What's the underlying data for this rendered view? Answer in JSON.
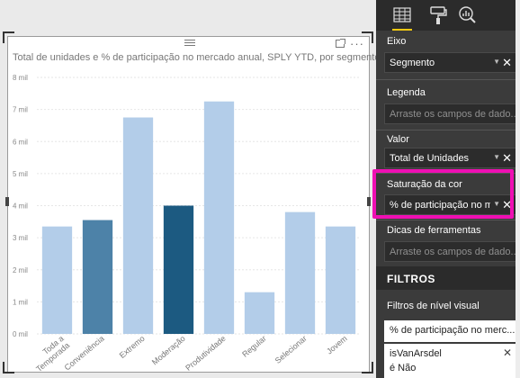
{
  "visual": {
    "title": "Total de unidades e % de participação no mercado anual, SPLY YTD, por segmento",
    "more_glyph": "···"
  },
  "chart_data": {
    "type": "bar",
    "title": "Total de unidades e % de participação no mercado anual, SPLY YTD, por segmento",
    "categories": [
      "Toda a Temporada",
      "Conveniência",
      "Extremo",
      "Moderação",
      "Produtividade",
      "Regular",
      "Selecionar",
      "Jovem"
    ],
    "values": [
      3.35,
      3.55,
      6.75,
      4.0,
      7.25,
      1.3,
      3.8,
      3.35
    ],
    "bar_colors": [
      "#b3cde9",
      "#4d82a8",
      "#b3cde9",
      "#1c5a81",
      "#b3cde9",
      "#b3cde9",
      "#b3cde9",
      "#b3cde9"
    ],
    "y_ticks": [
      "0 mil",
      "1 mil",
      "2 mil",
      "3 mil",
      "4 mil",
      "5 mil",
      "6 mil",
      "7 mil",
      "8 mil"
    ],
    "ylim": [
      0,
      8
    ],
    "grid": true,
    "xlabel": "",
    "ylabel": ""
  },
  "pane": {
    "tabs": [
      {
        "name": "fields-tab-icon",
        "active": true
      },
      {
        "name": "format-tab-icon",
        "active": false
      },
      {
        "name": "analytics-tab-icon",
        "active": false
      }
    ],
    "axis_label": "Eixo",
    "axis_value": "Segmento",
    "legend_label": "Legenda",
    "legend_placeholder": "Arraste os campos de dado...",
    "value_label": "Valor",
    "value_value": "Total de Unidades",
    "saturation_label": "Saturação da cor",
    "saturation_value": "% de participação no m",
    "tooltips_label": "Dicas de ferramentas",
    "tooltips_placeholder": "Arraste os campos de dado...",
    "filters_title": "FILTROS",
    "visual_filters_label": "Filtros de nível visual",
    "filter1": "% de participação no merc...",
    "filter2_name": "isVanArsdel",
    "filter2_value": "é Não",
    "remove_glyph": "✕",
    "dropdown_glyph": "▼"
  },
  "colors": {
    "highlight": "#ef0fb3",
    "pane_bg": "#3b3b3b",
    "accent": "#f2c811"
  }
}
